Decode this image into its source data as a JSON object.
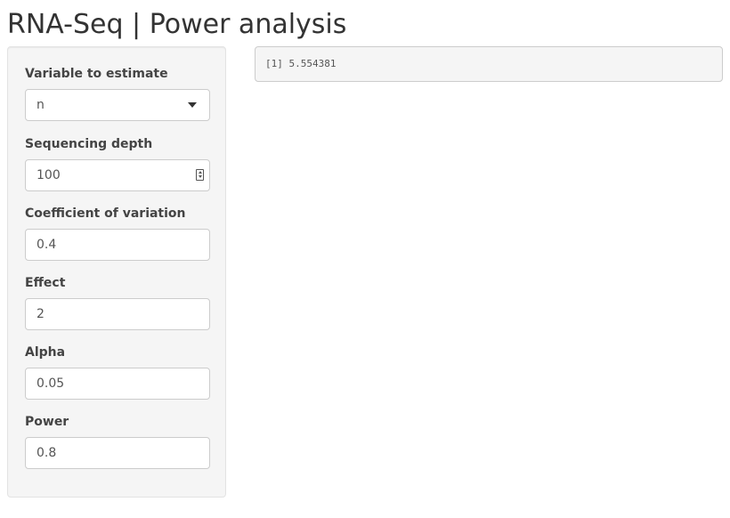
{
  "page": {
    "title": "RNA-Seq | Power analysis"
  },
  "sidebar": {
    "variable": {
      "label": "Variable to estimate",
      "value": "n"
    },
    "depth": {
      "label": "Sequencing depth",
      "value": "100"
    },
    "cv": {
      "label": "Coefficient of variation",
      "value": "0.4"
    },
    "effect": {
      "label": "Effect",
      "value": "2"
    },
    "alpha": {
      "label": "Alpha",
      "value": "0.05"
    },
    "power": {
      "label": "Power",
      "value": "0.8"
    }
  },
  "output": {
    "text": "[1] 5.554381"
  },
  "icons": {
    "select_caret": "chevron-down-icon",
    "number_spinner": "spinner-icon"
  },
  "colors": {
    "panel_bg": "#f5f5f5",
    "border": "#cccccc",
    "text": "#333333"
  }
}
